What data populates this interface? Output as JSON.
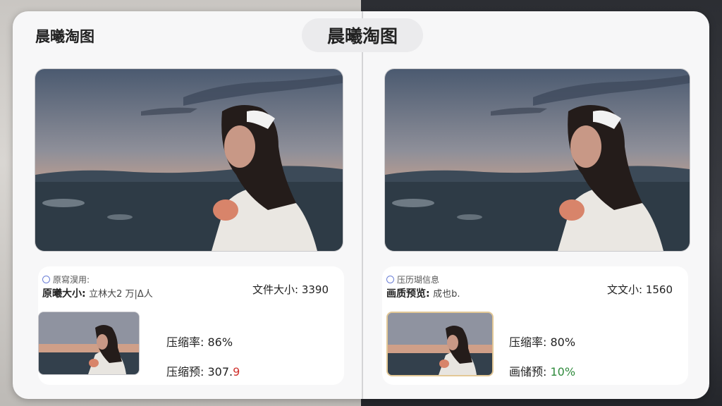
{
  "header": {
    "app_title": "晨曦淘图",
    "center_title": "晨曦淘图"
  },
  "left": {
    "status_text": "原寫淏用:",
    "info_key": "原曦大小:",
    "info_value": "立林⼤2 万|Δ人",
    "size_label": "文件大小:",
    "size_value": "3390",
    "stat1_label": "压缩率:",
    "stat1_value": "86%",
    "stat2_label": "压缩预:",
    "stat2_value": "307.",
    "stat2_highlight": "9"
  },
  "right": {
    "status_text": "压历瑚信息",
    "info_key": "画质预览:",
    "info_value": "成也b.",
    "size_label": "文文小:",
    "size_value": "1560",
    "stat1_label": "压缩率:",
    "stat1_value": "80%",
    "stat2_label": "画储预:",
    "stat2_value": "10%"
  },
  "colors": {
    "accent_red": "#d0312d",
    "accent_green": "#2f8a3c",
    "thumb_border_right": "#e3c896"
  }
}
